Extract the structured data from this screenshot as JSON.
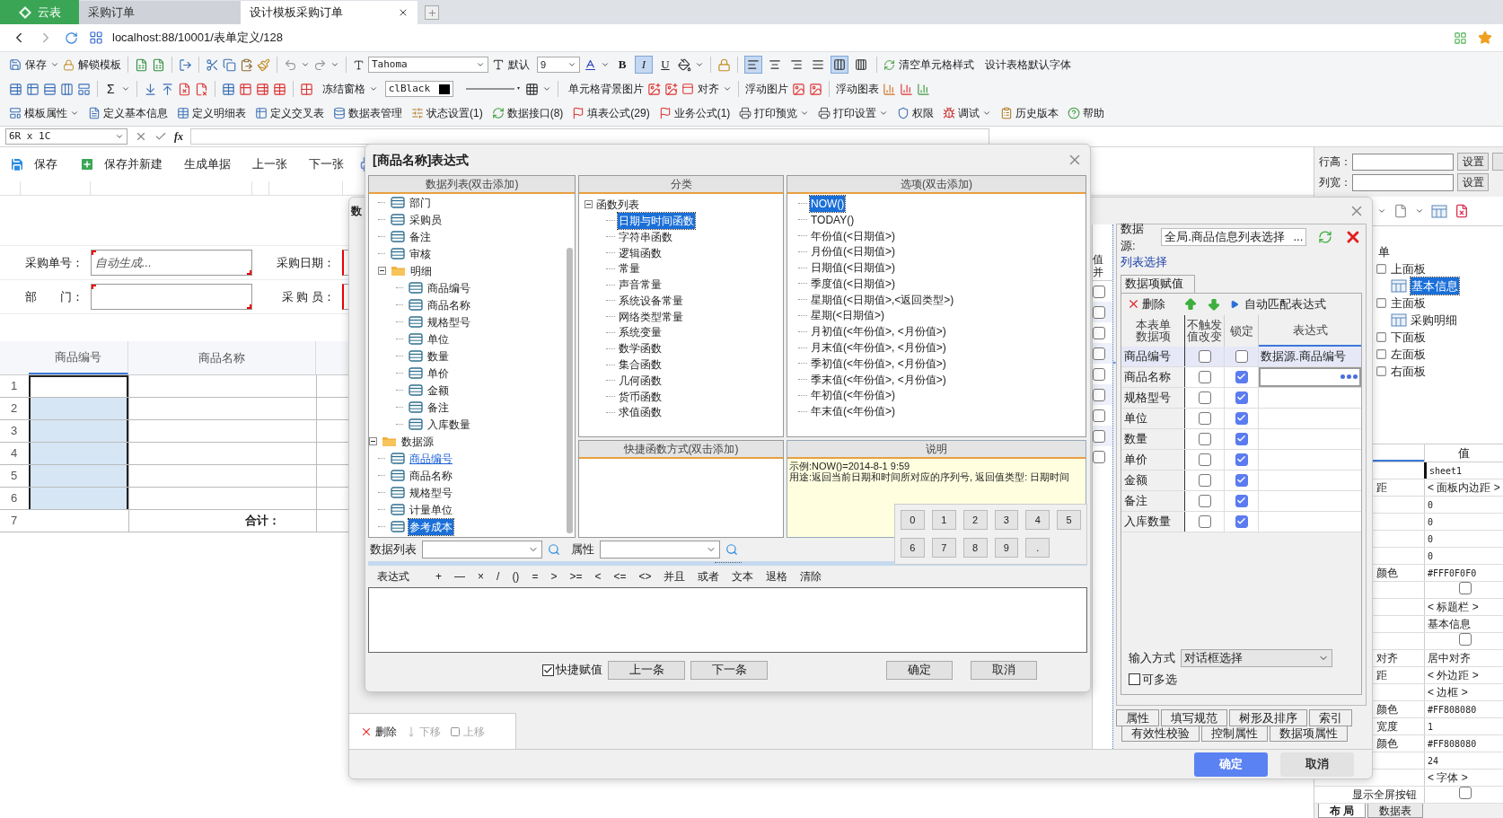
{
  "browser": {
    "tabs": [
      {
        "label": "云表",
        "kind": "app",
        "selected": false
      },
      {
        "label": "采购订单",
        "kind": "tab",
        "selected": false
      },
      {
        "label": "设计模板采购订单",
        "kind": "tab",
        "selected": true
      }
    ],
    "address": "localhost:88/10001/表单定义/128"
  },
  "toolbar_1": {
    "save": "保存",
    "unlock": "解锁模板",
    "font": "Tahoma",
    "size_label": "默认",
    "size": "9",
    "format": [
      {
        "label": "B",
        "selected": false
      },
      {
        "label": "I",
        "selected": true
      },
      {
        "label": "U",
        "selected": false
      }
    ],
    "align": [
      {
        "selected": true
      },
      {
        "selected": false
      },
      {
        "selected": false
      },
      {
        "selected": false
      },
      {
        "selected": true
      },
      {
        "selected": false
      }
    ],
    "clear": "清空单元格样式",
    "default_font": "设计表格默认字体"
  },
  "toolbar_2": {
    "sum": "Σ",
    "freeze": "冻结窗格",
    "color_name": "clBlack",
    "bg_image": "单元格背景图片",
    "align": "对齐",
    "float_image": "浮动图片",
    "float_chart": "浮动图表"
  },
  "toolbar_3": [
    {
      "label": "模板属性",
      "dropdown": true
    },
    {
      "label": "定义基本信息",
      "dropdown": false
    },
    {
      "label": "定义明细表",
      "dropdown": false
    },
    {
      "label": "定义交叉表",
      "dropdown": false
    },
    {
      "label": "数据表管理",
      "dropdown": false
    },
    {
      "label": "状态设置(1)",
      "dropdown": false
    },
    {
      "label": "数据接口(8)",
      "dropdown": false
    },
    {
      "label": "填表公式(29)",
      "dropdown": false
    },
    {
      "label": "业务公式(1)",
      "dropdown": false
    },
    {
      "label": "打印预览",
      "dropdown": true
    },
    {
      "label": "打印设置",
      "dropdown": true
    },
    {
      "label": "权限",
      "dropdown": false
    },
    {
      "label": "调试",
      "dropdown": true
    },
    {
      "label": "历史版本",
      "dropdown": false
    },
    {
      "label": "帮助",
      "dropdown": false
    }
  ],
  "formula_bar": {
    "cell": "6R x 1C",
    "fx": "fx"
  },
  "form": {
    "toolbar": [
      "保存",
      "保存并新建",
      "生成单据",
      "上一张",
      "下一张"
    ],
    "fields": [
      {
        "label": "采购单号：",
        "value": "自动生成..."
      },
      {
        "label": "采购日期："
      },
      {
        "label": "部　　门："
      },
      {
        "label": "采 购 员："
      }
    ],
    "columns": [
      "商品编号",
      "商品名称"
    ],
    "rows": [
      {
        "number": "1",
        "selected": true,
        "active": true
      },
      {
        "number": "2",
        "selected": true,
        "active": false
      },
      {
        "number": "3",
        "selected": true,
        "active": false
      },
      {
        "number": "4",
        "selected": true,
        "active": false
      },
      {
        "number": "5",
        "selected": true,
        "active": false
      },
      {
        "number": "6",
        "selected": true,
        "active": false
      },
      {
        "number": "7",
        "selected": false,
        "active": false,
        "total_label": "合计："
      }
    ]
  },
  "right_panel": {
    "row_height": {
      "label": "行高：",
      "button": "设置"
    },
    "col_width": {
      "label": "列宽：",
      "button": "设置"
    },
    "tree": {
      "label": "单",
      "children": [
        {
          "label": "上面板",
          "selected": false,
          "children": [
            {
              "label": "基本信息",
              "selected": true
            }
          ]
        },
        {
          "label": "主面板",
          "selected": false,
          "children": [
            {
              "label": "采购明细",
              "selected": false
            }
          ]
        },
        {
          "label": "下面板",
          "selected": false
        },
        {
          "label": "左面板",
          "selected": false
        },
        {
          "label": "右面板",
          "selected": false
        }
      ]
    },
    "value_header": "值",
    "properties": [
      {
        "value": "sheet1",
        "kind": "mono",
        "active": true
      },
      {
        "name": "距",
        "value": "< 面板内边距 >",
        "kind": "text",
        "active": false
      },
      {
        "value": "0",
        "kind": "mono",
        "active": false
      },
      {
        "value": "0",
        "kind": "mono",
        "active": false
      },
      {
        "value": "0",
        "kind": "mono",
        "active": false
      },
      {
        "value": "0",
        "kind": "mono",
        "active": false
      },
      {
        "name": "颜色",
        "value": "#FFF0F0F0",
        "kind": "mono",
        "active": false
      },
      {
        "kind": "check",
        "checked": false,
        "active": false
      },
      {
        "value": "< 标题栏 >",
        "kind": "text",
        "active": false
      },
      {
        "value": "基本信息",
        "kind": "text",
        "active": false
      },
      {
        "kind": "check",
        "checked": false,
        "active": false
      },
      {
        "name": "对齐",
        "value": "居中对齐",
        "kind": "text",
        "active": false
      },
      {
        "name": "距",
        "value": "< 外边距 >",
        "kind": "text",
        "active": false
      },
      {
        "value": "< 边框 >",
        "kind": "text",
        "active": false
      },
      {
        "name": "颜色",
        "value": "#FF808080",
        "kind": "mono",
        "active": false
      },
      {
        "name": "宽度",
        "value": "1",
        "kind": "mono",
        "active": false
      },
      {
        "name": "颜色",
        "value": "#FF808080",
        "kind": "mono",
        "active": false
      },
      {
        "value": "24",
        "kind": "mono",
        "active": false
      },
      {
        "value": "< 字体 >",
        "kind": "text",
        "active": false
      },
      {
        "name": "显示全屏按钮",
        "kind": "check",
        "checked": false,
        "active": false
      }
    ],
    "bottom_tabs": [
      {
        "label": "布 局",
        "selected": true
      },
      {
        "label": "数据表",
        "selected": false
      }
    ]
  },
  "assign_dialog": {
    "fragment": "数",
    "side_header": [
      "值",
      "并"
    ],
    "side_rows": [
      {
        "checked": false
      },
      {
        "checked": false
      },
      {
        "checked": false
      },
      {
        "checked": false
      },
      {
        "checked": false
      },
      {
        "checked": false
      },
      {
        "checked": false
      },
      {
        "checked": false
      },
      {
        "checked": false
      }
    ],
    "datasource": {
      "label": "数据源:",
      "value": "全局.商品信息列表选择",
      "more": "..."
    },
    "link": "列表选择",
    "tab": "数据项赋值",
    "delete": "删除",
    "auto_match": "自动匹配表达式",
    "columns": [
      "本表单数据项",
      "不触发值改变",
      "锁定",
      "表达式"
    ],
    "rows": [
      {
        "name": "商品编号",
        "no_trigger": false,
        "locked": false,
        "expression": "数据源.商品编号",
        "selected": true,
        "editing": false
      },
      {
        "name": "商品名称",
        "no_trigger": false,
        "locked": true,
        "selected": false,
        "editing": true
      },
      {
        "name": "规格型号",
        "no_trigger": false,
        "locked": true,
        "selected": false,
        "editing": false
      },
      {
        "name": "单位",
        "no_trigger": false,
        "locked": true,
        "selected": false,
        "editing": false
      },
      {
        "name": "数量",
        "no_trigger": false,
        "locked": true,
        "selected": false,
        "editing": false
      },
      {
        "name": "单价",
        "no_trigger": false,
        "locked": true,
        "selected": false,
        "editing": false
      },
      {
        "name": "金额",
        "no_trigger": false,
        "locked": true,
        "selected": false,
        "editing": false
      },
      {
        "name": "备注",
        "no_trigger": false,
        "locked": true,
        "selected": false,
        "editing": false
      },
      {
        "name": "入库数量",
        "no_trigger": false,
        "locked": true,
        "selected": false,
        "editing": false
      }
    ],
    "input_mode": {
      "label": "输入方式",
      "value": "对话框选择"
    },
    "multi": {
      "label": "可多选",
      "checked": false
    },
    "tabs_row_1": [
      {
        "label": "属性",
        "selected": false
      },
      {
        "label": "填写规范",
        "selected": false
      },
      {
        "label": "树形及排序",
        "selected": false
      },
      {
        "label": "索引",
        "selected": false
      }
    ],
    "tabs_row_2": [
      {
        "label": "有效性校验",
        "selected": false
      },
      {
        "label": "控制属性",
        "selected": false
      },
      {
        "label": "数据项属性",
        "selected": false
      }
    ],
    "list_actions": [
      {
        "label": "删除",
        "disabled": false
      },
      {
        "label": "下移",
        "disabled": true
      },
      {
        "label": "上移",
        "disabled": true
      }
    ],
    "buttons": [
      {
        "label": "确定",
        "kind": "primary"
      },
      {
        "label": "取消",
        "kind": "secondary"
      }
    ]
  },
  "expression_dialog": {
    "title": "[商品名称]表达式",
    "data_list": {
      "header": "数据列表(双击添加)",
      "items": [
        {
          "kind": "hidden",
          "children": [
            {
              "label": "部门",
              "kind": "field",
              "selected": false,
              "hovered": false
            },
            {
              "label": "采购员",
              "kind": "field",
              "selected": false,
              "hovered": false
            },
            {
              "label": "备注",
              "kind": "field",
              "selected": false,
              "hovered": false
            },
            {
              "label": "审核",
              "kind": "field",
              "selected": false,
              "hovered": false
            },
            {
              "label": "明细",
              "kind": "folder",
              "expanded": true,
              "children": [
                {
                  "label": "商品编号",
                  "kind": "field",
                  "selected": false,
                  "hovered": false
                },
                {
                  "label": "商品名称",
                  "kind": "field",
                  "selected": false,
                  "hovered": false
                },
                {
                  "label": "规格型号",
                  "kind": "field",
                  "selected": false,
                  "hovered": false
                },
                {
                  "label": "单位",
                  "kind": "field",
                  "selected": false,
                  "hovered": false
                },
                {
                  "label": "数量",
                  "kind": "field",
                  "selected": false,
                  "hovered": false
                },
                {
                  "label": "单价",
                  "kind": "field",
                  "selected": false,
                  "hovered": false
                },
                {
                  "label": "金额",
                  "kind": "field",
                  "selected": false,
                  "hovered": false
                },
                {
                  "label": "备注",
                  "kind": "field",
                  "selected": false,
                  "hovered": false
                },
                {
                  "label": "入库数量",
                  "kind": "field",
                  "selected": false,
                  "hovered": false
                }
              ]
            }
          ]
        },
        {
          "label": "数据源",
          "kind": "folder",
          "expanded": true,
          "children": [
            {
              "label": "商品编号",
              "kind": "field",
              "selected": false,
              "hovered": true
            },
            {
              "label": "商品名称",
              "kind": "field",
              "selected": false,
              "hovered": false
            },
            {
              "label": "规格型号",
              "kind": "field",
              "selected": false,
              "hovered": false
            },
            {
              "label": "计量单位",
              "kind": "field",
              "selected": false,
              "hovered": false
            },
            {
              "label": "参考成本",
              "kind": "field",
              "selected": true,
              "hovered": false
            }
          ]
        }
      ]
    },
    "category": {
      "header": "分类",
      "root": "函数列表",
      "expanded": true,
      "items": [
        {
          "label": "日期与时间函数",
          "selected": true
        },
        {
          "label": "字符串函数",
          "selected": false
        },
        {
          "label": "逻辑函数",
          "selected": false
        },
        {
          "label": "常量",
          "selected": false
        },
        {
          "label": "声音常量",
          "selected": false
        },
        {
          "label": "系统设备常量",
          "selected": false
        },
        {
          "label": "网络类型常量",
          "selected": false
        },
        {
          "label": "系统变量",
          "selected": false
        },
        {
          "label": "数学函数",
          "selected": false
        },
        {
          "label": "集合函数",
          "selected": false
        },
        {
          "label": "几何函数",
          "selected": false
        },
        {
          "label": "货币函数",
          "selected": false
        },
        {
          "label": "求值函数",
          "selected": false
        }
      ]
    },
    "options": {
      "header": "选项(双击添加)",
      "items": [
        {
          "label": "NOW()",
          "selected": true
        },
        {
          "label": "TODAY()",
          "selected": false
        },
        {
          "label": "年份值(<日期值>)",
          "selected": false
        },
        {
          "label": "月份值(<日期值>)",
          "selected": false
        },
        {
          "label": "日期值(<日期值>)",
          "selected": false
        },
        {
          "label": "季度值(<日期值>)",
          "selected": false
        },
        {
          "label": "星期值(<日期值>,<返回类型>)",
          "selected": false
        },
        {
          "label": "星期(<日期值>)",
          "selected": false
        },
        {
          "label": "月初值(<年份值>, <月份值>)",
          "selected": false
        },
        {
          "label": "月末值(<年份值>, <月份值>)",
          "selected": false
        },
        {
          "label": "季初值(<年份值>, <月份值>)",
          "selected": false
        },
        {
          "label": "季末值(<年份值>, <月份值>)",
          "selected": false
        },
        {
          "label": "年初值(<年份值>)",
          "selected": false
        },
        {
          "label": "年末值(<年份值>)",
          "selected": false
        }
      ]
    },
    "shortcut": {
      "header": "快捷函数方式(双击添加)"
    },
    "description": {
      "header": "说明",
      "lines": [
        "示例:NOW()=2014-8-1 9:59",
        "用途:返回当前日期和时间所对应的序列号, 返回值类型: 日期时间"
      ]
    },
    "numpad": [
      "0",
      "1",
      "2",
      "3",
      "4",
      "5",
      "6",
      "7",
      "8",
      "9",
      "."
    ],
    "filters": [
      {
        "label": "数据列表"
      },
      {
        "label": "属性"
      }
    ],
    "operator_label": "表达式",
    "operators": [
      "+",
      "—",
      "×",
      "/",
      "()",
      "=",
      ">",
      ">=",
      "<",
      "<=",
      "<>",
      "并且",
      "或者",
      "文本",
      "退格",
      "清除"
    ],
    "quick_assign": {
      "label": "快捷赋值",
      "checked": true
    },
    "nav_buttons": [
      "上一条",
      "下一条"
    ],
    "buttons": [
      "确定",
      "取消"
    ]
  }
}
